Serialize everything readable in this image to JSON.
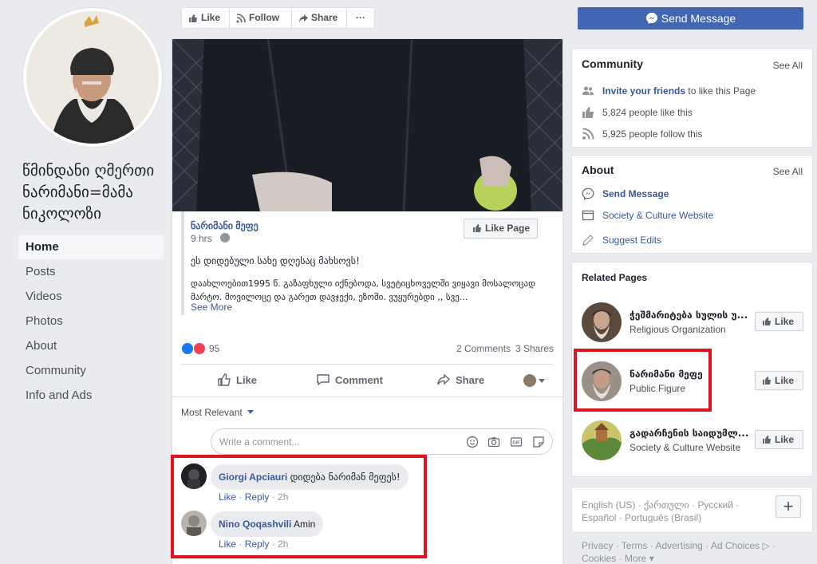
{
  "sidebar": {
    "page_name_lines": [
      "წმინდანი ღმერთი",
      "ნარიმანი=მამა",
      "ნიკოლოზი"
    ],
    "nav": [
      "Home",
      "Posts",
      "Videos",
      "Photos",
      "About",
      "Community",
      "Info and Ads"
    ],
    "active": "Home"
  },
  "toolbar": {
    "like": "Like",
    "follow": "Follow",
    "share": "Share",
    "more": "···"
  },
  "post": {
    "shared_author": "ნარიმანი მეფე",
    "time": "9 hrs",
    "like_page": "Like Page",
    "text_line1": "ეს დიდებული სახე დღესაც მახსოვს!",
    "text_line2": "დაახლოებით1995 წ. გაზაფხული იქნებოდა, სვეტიცხოველში ვიყავი მოსალოცად",
    "text_line3": "მარტო. მოვილოცე და გარეთ დავჯექი, ეზოში. ვუყურებდი ,, სვე...",
    "see_more": "See More",
    "reaction_count": "95",
    "comments": "2 Comments",
    "shares": "3 Shares",
    "actions": {
      "like": "Like",
      "comment": "Comment",
      "share": "Share"
    },
    "sort": "Most Relevant",
    "comment_placeholder": "Write a comment..."
  },
  "comments": [
    {
      "author": "Giorgi Apciauri",
      "text": "დიდება ნარიმან მეფეს!",
      "like": "Like",
      "reply": "Reply",
      "time": "2h"
    },
    {
      "author": "Nino Qoqashvili",
      "text": "Amin",
      "like": "Like",
      "reply": "Reply",
      "time": "2h"
    }
  ],
  "right": {
    "send_message": "Send Message",
    "community": {
      "title": "Community",
      "see_all": "See All",
      "invite_link": "Invite your friends",
      "invite_rest": " to like this Page",
      "likes": "5,824 people like this",
      "follows": "5,925 people follow this"
    },
    "about": {
      "title": "About",
      "see_all": "See All",
      "send_message": "Send Message",
      "category": "Society & Culture Website",
      "suggest": "Suggest Edits"
    },
    "related": {
      "title": "Related Pages",
      "pages": [
        {
          "name": "ჭეშმარიტება სულის უ...",
          "category": "Religious Organization",
          "like": "Like"
        },
        {
          "name": "ნარიმანი მეფე",
          "category": "Public Figure",
          "like": "Like"
        },
        {
          "name": "გადარჩენის საიდუმლ...",
          "category": "Society & Culture Website",
          "like": "Like"
        }
      ]
    },
    "languages": {
      "line1": "English (US) · ქართული · Русский ·",
      "line2": "Español · Português (Brasil)",
      "plus": "+"
    },
    "footer": {
      "line1": "Privacy · Terms · Advertising · Ad Choices ▷ ·",
      "line2": "Cookies · More ▾"
    }
  },
  "colors": {
    "brand_blue": "#4267b2",
    "link": "#385898",
    "highlight": "#e0141e",
    "bg": "#e9ebee"
  }
}
